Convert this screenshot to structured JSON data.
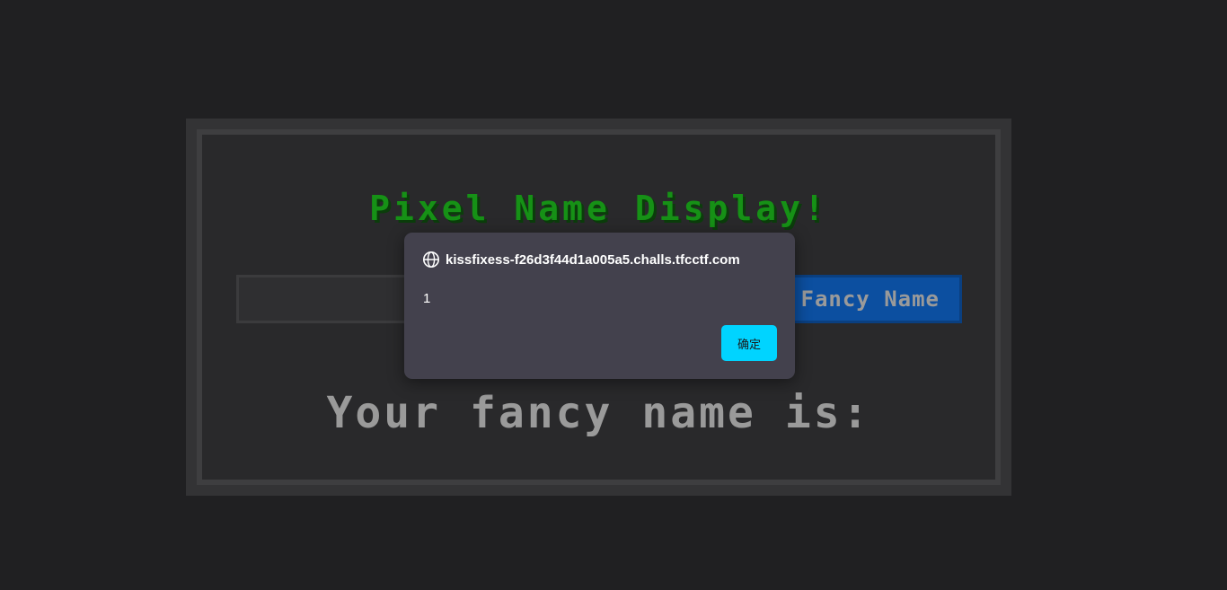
{
  "app": {
    "title": "Pixel Name Display!",
    "input_value": "",
    "button_label": "Fancy Name",
    "result_text": "Your fancy name is:"
  },
  "dialog": {
    "origin": "kissfixess-f26d3f44d1a005a5.challs.tfcctf.com",
    "message": "1",
    "ok_label": "确定",
    "icon": "globe-icon",
    "accent_color": "#00d4ff"
  },
  "colors": {
    "title": "#169116",
    "button": "#0c4fa0",
    "background": "#202022"
  }
}
